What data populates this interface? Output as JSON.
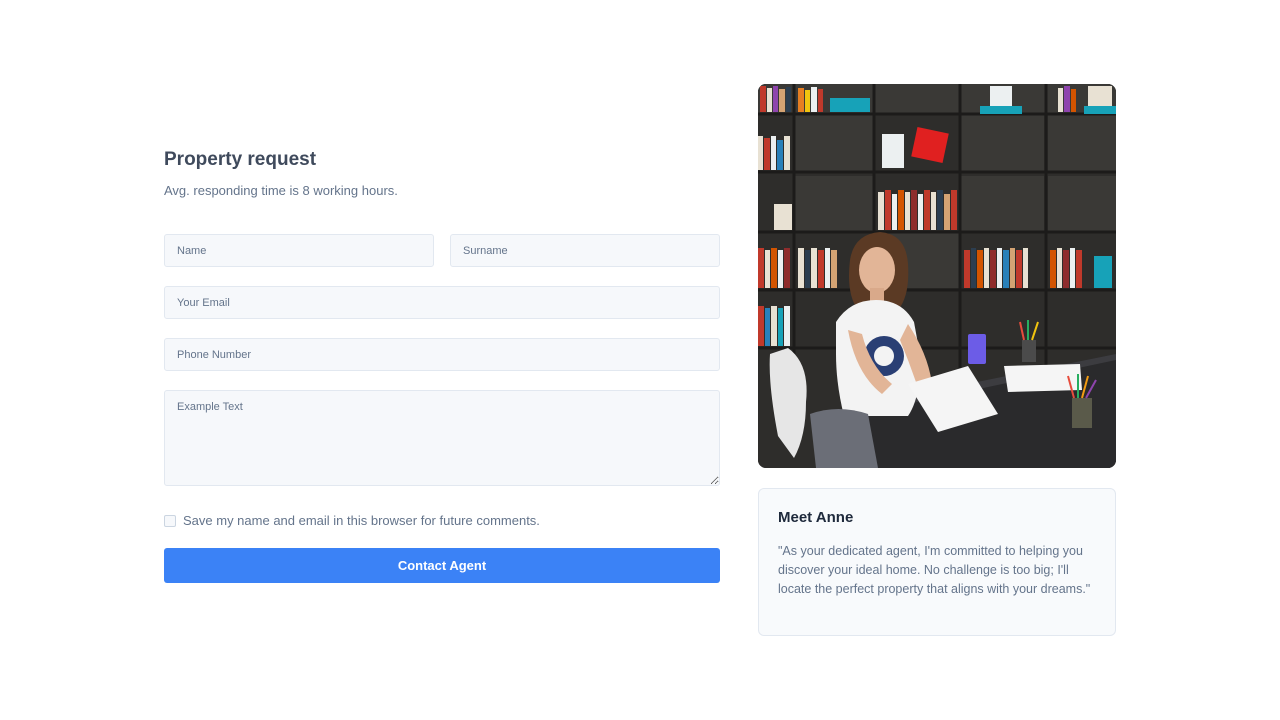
{
  "form": {
    "title": "Property request",
    "subtitle": "Avg. responding time is 8 working hours.",
    "name_placeholder": "Name",
    "surname_placeholder": "Surname",
    "email_placeholder": "Your Email",
    "phone_placeholder": "Phone Number",
    "message_placeholder": "Example Text",
    "consent_label": "Save my name and email in this browser for future comments.",
    "submit_label": "Contact Agent"
  },
  "agent": {
    "name": "Meet Anne",
    "quote": "\"As your dedicated agent, I'm committed to helping you discover your ideal home. No challenge is too big; I'll locate the perfect property that aligns with your dreams.\""
  },
  "colors": {
    "accent": "#3b82f6",
    "field_background": "#f6f8fb",
    "card_background": "#f8fafc"
  }
}
